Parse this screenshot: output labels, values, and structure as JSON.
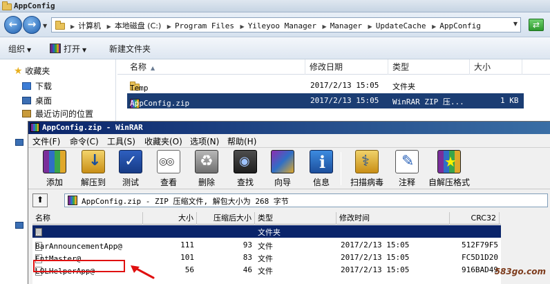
{
  "explorer": {
    "title": "AppConfig",
    "breadcrumbs": [
      "计算机",
      "本地磁盘 (C:)",
      "Program Files",
      "Yileyoo Manager",
      "Manager",
      "UpdateCache",
      "AppConfig"
    ],
    "toolbar": {
      "organize": "组织",
      "open": "打开",
      "new_folder": "新建文件夹"
    },
    "nav": {
      "favorites": "收藏夹",
      "downloads": "下载",
      "desktop": "桌面",
      "recent": "最近访问的位置"
    },
    "columns": {
      "name": "名称",
      "modified": "修改日期",
      "type": "类型",
      "size": "大小"
    },
    "files": [
      {
        "name": "Temp",
        "modified": "2017/2/13 15:05",
        "type": "文件夹",
        "size": ""
      },
      {
        "name": "AppConfig.zip",
        "modified": "2017/2/13 15:05",
        "type": "WinRAR ZIP 压...",
        "size": "1 KB"
      }
    ]
  },
  "winrar": {
    "title": "AppConfig.zip - WinRAR",
    "menu": [
      "文件(F)",
      "命令(C)",
      "工具(S)",
      "收藏夹(O)",
      "选项(N)",
      "帮助(H)"
    ],
    "tools": [
      "添加",
      "解压到",
      "测试",
      "查看",
      "删除",
      "查找",
      "向导",
      "信息",
      "扫描病毒",
      "注释",
      "自解压格式"
    ],
    "path_text": "AppConfig.zip - ZIP 压缩文件, 解包大小为 268 字节",
    "columns": {
      "name": "名称",
      "size": "大小",
      "packed": "压缩后大小",
      "type": "类型",
      "modified": "修改时间",
      "crc": "CRC32"
    },
    "rows": [
      {
        "name": "..",
        "size": "",
        "packed": "",
        "type": "文件夹",
        "modified": "",
        "crc": ""
      },
      {
        "name": "BarAnnouncementApp@",
        "size": "111",
        "packed": "93",
        "type": "文件",
        "modified": "2017/2/13 15:05",
        "crc": "512F79F5"
      },
      {
        "name": "EntMaster@",
        "size": "101",
        "packed": "83",
        "type": "文件",
        "modified": "2017/2/13 15:05",
        "crc": "FC5D1D20"
      },
      {
        "name": "LOLHelperApp@",
        "size": "56",
        "packed": "46",
        "type": "文件",
        "modified": "2017/2/13 15:05",
        "crc": "916BAD49"
      }
    ]
  },
  "watermark": "583go.com",
  "colors": {
    "highlight": "#e01010",
    "selection": "#1b3d73",
    "winrar_title": "#0a246a"
  }
}
